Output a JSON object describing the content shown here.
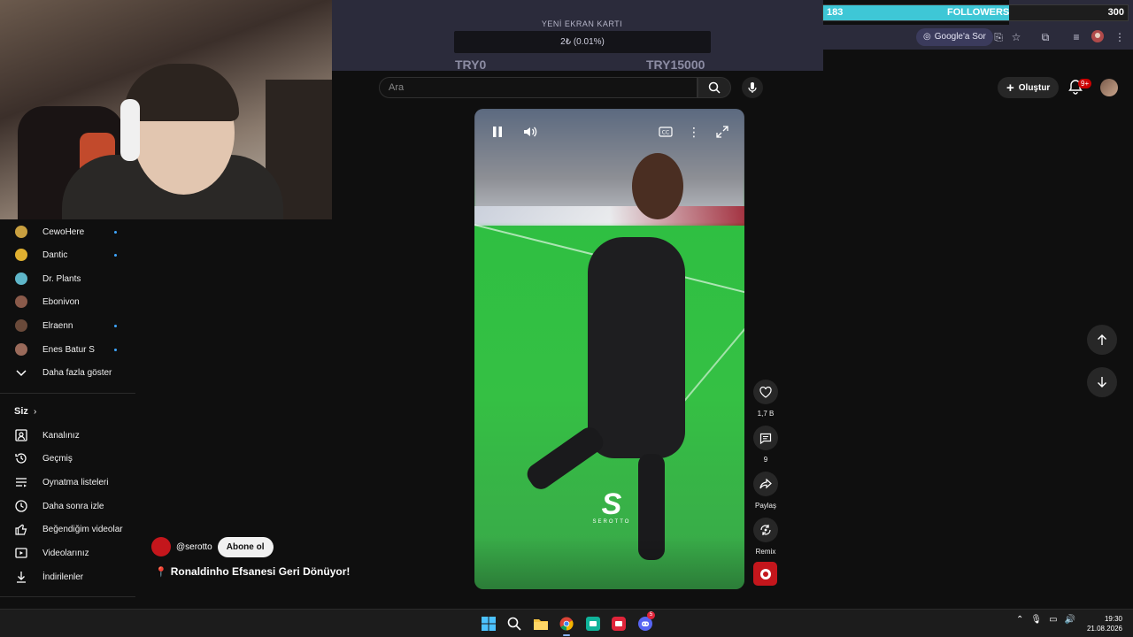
{
  "overlay": {
    "goal_title": "YENİ EKRAN KARTI",
    "goal_progress": "2₺ (0.01%)",
    "goal_min": "TRY0",
    "goal_max": "TRY15000",
    "followers": {
      "count": "183",
      "label": "FOLLOWERS",
      "goal": "300",
      "fill_fraction": 0.61
    }
  },
  "browser": {
    "ask_google_label": "Google'a Sor",
    "icons": [
      "google-lens-icon",
      "install-app-icon",
      "bookmark-star-icon",
      "extensions-icon",
      "media-controls-icon",
      "profile-icon",
      "more-vert-icon"
    ]
  },
  "masthead": {
    "search_placeholder": "Ara",
    "create_label": "Oluştur",
    "notification_badge": "9+"
  },
  "sidebar": {
    "subscriptions": [
      {
        "label": "CewoHere",
        "color": "#c9a040",
        "new": true
      },
      {
        "label": "Dantic",
        "color": "#e0b030",
        "new": true
      },
      {
        "label": "Dr. Plants",
        "color": "#5fb6c9",
        "new": false
      },
      {
        "label": "Ebonivon",
        "color": "#8a5a4a",
        "new": false
      },
      {
        "label": "Elraenn",
        "color": "#6a4a3a",
        "new": true
      },
      {
        "label": "Enes Batur S",
        "color": "#9a6a5a",
        "new": true
      }
    ],
    "show_more_label": "Daha fazla göster",
    "you_section_label": "Siz",
    "you_items": [
      {
        "label": "Kanalınız",
        "icon": "channel-icon"
      },
      {
        "label": "Geçmiş",
        "icon": "history-icon"
      },
      {
        "label": "Oynatma listeleri",
        "icon": "playlists-icon"
      },
      {
        "label": "Daha sonra izle",
        "icon": "watch-later-icon"
      },
      {
        "label": "Beğendiğim videolar",
        "icon": "liked-videos-icon"
      },
      {
        "label": "Videolarınız",
        "icon": "your-videos-icon"
      },
      {
        "label": "İndirilenler",
        "icon": "downloads-icon"
      }
    ]
  },
  "short": {
    "watermark_text": "SEROTTO",
    "channel_handle": "@serotto",
    "subscribe_label": "Abone ol",
    "title": "Ronaldinho Efsanesi Geri Dönüyor!",
    "actions": [
      {
        "icon": "like-icon",
        "label": "1,7 B"
      },
      {
        "icon": "comment-icon",
        "label": "9"
      },
      {
        "icon": "share-icon",
        "label": "Paylaş"
      },
      {
        "icon": "remix-icon",
        "label": "Remix"
      }
    ]
  },
  "taskbar": {
    "time": "19:30",
    "date": "21.08.2026",
    "discord_badge": "5"
  }
}
